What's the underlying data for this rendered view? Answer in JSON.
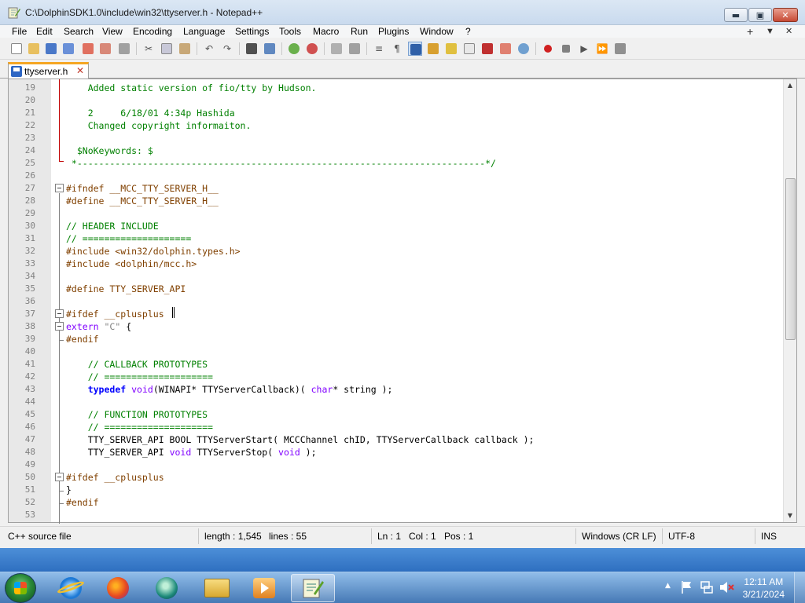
{
  "window": {
    "title": "C:\\DolphinSDK1.0\\include\\win32\\ttyserver.h - Notepad++",
    "minimize_label": "▬",
    "maximize_label": "▣",
    "close_label": "✕"
  },
  "menu": {
    "items": [
      "File",
      "Edit",
      "Search",
      "View",
      "Encoding",
      "Language",
      "Settings",
      "Tools",
      "Macro",
      "Run",
      "Plugins",
      "Window",
      "?"
    ],
    "right_plus": "+",
    "right_down": "▼",
    "right_close": "✕"
  },
  "tab": {
    "label": "ttyserver.h",
    "close_icon": "✕"
  },
  "editor": {
    "lines": [
      {
        "num": "19",
        "segments": [
          {
            "t": "    Added static version of fio/tty by Hudson.",
            "c": "c-comment"
          }
        ]
      },
      {
        "num": "20",
        "segments": []
      },
      {
        "num": "21",
        "segments": [
          {
            "t": "    2     6/18/01 4:34p Hashida",
            "c": "c-comment"
          }
        ]
      },
      {
        "num": "22",
        "segments": [
          {
            "t": "    Changed copyright informaiton.",
            "c": "c-comment"
          }
        ]
      },
      {
        "num": "23",
        "segments": []
      },
      {
        "num": "24",
        "segments": [
          {
            "t": "  $NoKeywords: $",
            "c": "c-comment"
          }
        ]
      },
      {
        "num": "25",
        "segments": [
          {
            "t": " *---------------------------------------------------------------------------*/",
            "c": "c-comment"
          }
        ]
      },
      {
        "num": "26",
        "segments": []
      },
      {
        "num": "27",
        "segments": [
          {
            "t": "#ifndef __MCC_TTY_SERVER_H__",
            "c": "c-pre"
          }
        ]
      },
      {
        "num": "28",
        "segments": [
          {
            "t": "#define __MCC_TTY_SERVER_H__",
            "c": "c-pre"
          }
        ]
      },
      {
        "num": "29",
        "segments": []
      },
      {
        "num": "30",
        "segments": [
          {
            "t": "// HEADER INCLUDE",
            "c": "c-comment"
          }
        ]
      },
      {
        "num": "31",
        "segments": [
          {
            "t": "// ====================",
            "c": "c-comment"
          }
        ]
      },
      {
        "num": "32",
        "segments": [
          {
            "t": "#include <win32/dolphin.types.h>",
            "c": "c-pre"
          }
        ]
      },
      {
        "num": "33",
        "segments": [
          {
            "t": "#include <dolphin/mcc.h>",
            "c": "c-pre"
          }
        ]
      },
      {
        "num": "34",
        "segments": []
      },
      {
        "num": "35",
        "segments": [
          {
            "t": "#define TTY_SERVER_API",
            "c": "c-pre"
          }
        ]
      },
      {
        "num": "36",
        "segments": []
      },
      {
        "num": "37",
        "segments": [
          {
            "t": "#ifdef __cplusplus",
            "c": "c-pre"
          }
        ]
      },
      {
        "num": "38",
        "segments": [
          {
            "t": "extern",
            "c": "c-type"
          },
          {
            "t": " ",
            "c": ""
          },
          {
            "t": "\"C\"",
            "c": "c-str"
          },
          {
            "t": " {",
            "c": ""
          }
        ]
      },
      {
        "num": "39",
        "segments": [
          {
            "t": "#endif",
            "c": "c-pre"
          }
        ]
      },
      {
        "num": "40",
        "segments": []
      },
      {
        "num": "41",
        "segments": [
          {
            "t": "    // CALLBACK PROTOTYPES",
            "c": "c-comment"
          }
        ]
      },
      {
        "num": "42",
        "segments": [
          {
            "t": "    // ====================",
            "c": "c-comment"
          }
        ]
      },
      {
        "num": "43",
        "segments": [
          {
            "t": "    ",
            "c": ""
          },
          {
            "t": "typedef",
            "c": "c-kw"
          },
          {
            "t": " ",
            "c": ""
          },
          {
            "t": "void",
            "c": "c-type"
          },
          {
            "t": "(WINAPI* TTYServerCallback)( ",
            "c": ""
          },
          {
            "t": "char",
            "c": "c-type"
          },
          {
            "t": "* string );",
            "c": ""
          }
        ]
      },
      {
        "num": "44",
        "segments": []
      },
      {
        "num": "45",
        "segments": [
          {
            "t": "    // FUNCTION PROTOTYPES",
            "c": "c-comment"
          }
        ]
      },
      {
        "num": "46",
        "segments": [
          {
            "t": "    // ====================",
            "c": "c-comment"
          }
        ]
      },
      {
        "num": "47",
        "segments": [
          {
            "t": "    TTY_SERVER_API BOOL TTYServerStart( MCCChannel chID, TTYServerCallback callback );",
            "c": ""
          }
        ]
      },
      {
        "num": "48",
        "segments": [
          {
            "t": "    TTY_SERVER_API ",
            "c": ""
          },
          {
            "t": "void",
            "c": "c-type"
          },
          {
            "t": " TTYServerStop( ",
            "c": ""
          },
          {
            "t": "void",
            "c": "c-type"
          },
          {
            "t": " );",
            "c": ""
          }
        ]
      },
      {
        "num": "49",
        "segments": []
      },
      {
        "num": "50",
        "segments": [
          {
            "t": "#ifdef __cplusplus",
            "c": "c-pre"
          }
        ]
      },
      {
        "num": "51",
        "segments": [
          {
            "t": "}",
            "c": ""
          }
        ]
      },
      {
        "num": "52",
        "segments": [
          {
            "t": "#endif",
            "c": "c-pre"
          }
        ]
      },
      {
        "num": "53",
        "segments": []
      }
    ]
  },
  "statusbar": {
    "filetype": "C++ source file",
    "length": "length : 1,545",
    "lines": "lines : 55",
    "ln": "Ln : 1",
    "col": "Col : 1",
    "pos": "Pos : 1",
    "eol": "Windows (CR LF)",
    "encoding": "UTF-8",
    "mode": "INS"
  },
  "taskbar": {
    "clock_time": "12:11 AM",
    "clock_date": "3/21/2024",
    "tray_arrow": "▲"
  }
}
